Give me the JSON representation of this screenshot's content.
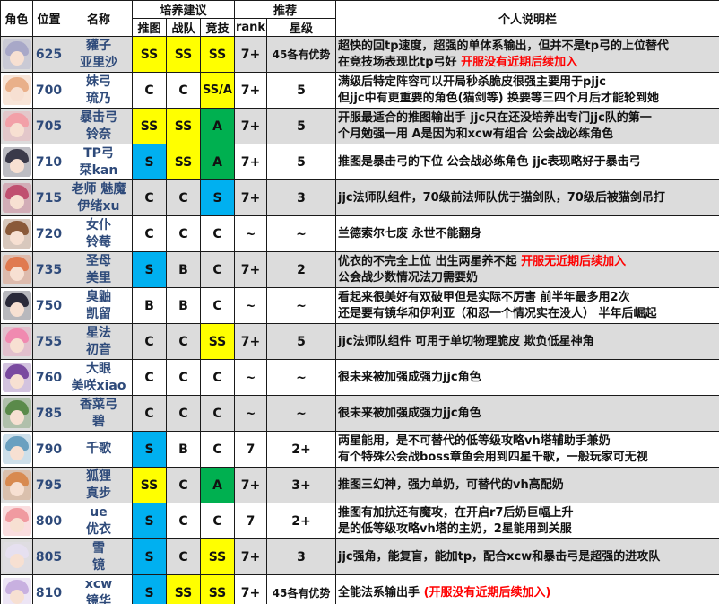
{
  "header": {
    "col_role": "角色",
    "col_pos": "位置",
    "col_name": "名称",
    "group_train": "培养建议",
    "col_push": "推图",
    "col_team": "战队",
    "col_arena": "竞技",
    "group_rec": "推荐",
    "col_rank": "rank",
    "col_star": "星级",
    "col_note": "个人说明栏"
  },
  "colors": {
    "SS": "#ffff00",
    "S": "#00b0f0",
    "A": "#00b050",
    "shade": "#dcdcdc",
    "name_text": "#2e4a7a",
    "highlight_text": "#ff0000"
  },
  "rows": [
    {
      "pos": "625",
      "name1": "䝔子",
      "name2": "亚里沙",
      "push": "SS",
      "team": "SS",
      "arena": "SS",
      "rank": "7+",
      "star": "45各有优势",
      "note1": "超快的回tp速度，超强的单体系输出，但并不是tp弓的上位替代",
      "note2": "在竞技场表现比tp弓好",
      "note2_red": "开服没有近期后续加入",
      "avatar_icon": "aris-avatar-icon",
      "hair": "#a8a8c8"
    },
    {
      "pos": "700",
      "name1": "妹弓",
      "name2": "琉乃",
      "push": "C",
      "team": "C",
      "arena": "SS/A",
      "rank": "7+",
      "star": "5",
      "note1": "满级后特定阵容可以开局秒杀脆皮很强主要用于pjjc",
      "note2": "但jjc中有更重要的角色(猫剑等)  换要等三四个月后才能轮到她",
      "note2_red": "",
      "avatar_icon": "rino-avatar-icon",
      "hair": "#e9b08a"
    },
    {
      "pos": "705",
      "name1": "暴击弓",
      "name2": "铃奈",
      "push": "SS",
      "team": "SS",
      "arena": "A",
      "rank": "7+",
      "star": "5",
      "note1": "开服最适合的推图输出手 jjc只在还没培养出专门jjc队的第一",
      "note2": "个月勉强一用  A是因为和xcw有组合      公会战必练角色",
      "note2_red": "",
      "avatar_icon": "suzuna-avatar-icon",
      "hair": "#f2a0a8"
    },
    {
      "pos": "710",
      "name1": "TP弓",
      "name2": "栞kan",
      "push": "S",
      "team": "SS",
      "arena": "A",
      "rank": "7+",
      "star": "5",
      "note1": "推图是暴击弓的下位  公会战必练角色  jjc表现略好于暴击弓",
      "note2": "",
      "note2_red": "",
      "avatar_icon": "shiori-avatar-icon",
      "hair": "#3a3a4a"
    },
    {
      "pos": "715",
      "name1": "老师 魅魔",
      "name2": "伊绪xu",
      "push": "C",
      "team": "C",
      "arena": "S",
      "rank": "7+",
      "star": "3",
      "note1": "jjc法师队组件，70级前法师队优于猫剑队，70级后被猫剑吊打",
      "note2": "",
      "note2_red": "",
      "avatar_icon": "io-avatar-icon",
      "hair": "#c05070"
    },
    {
      "pos": "720",
      "name1": "女仆",
      "name2": "铃莓",
      "push": "C",
      "team": "C",
      "arena": "C",
      "rank": "~",
      "star": "~",
      "note1": "兰德索尔七废 永世不能翻身",
      "note2": "",
      "note2_red": "",
      "avatar_icon": "suzume-avatar-icon",
      "hair": "#8a5a3a"
    },
    {
      "pos": "735",
      "name1": "圣母",
      "name2": "美里",
      "push": "S",
      "team": "B",
      "arena": "C",
      "rank": "7+",
      "star": "2",
      "note1": "优衣的不完全上位 出生两星养不起",
      "note1_red": "开服无近期后续加入",
      "note2": "公会战少数情况法刀需要奶",
      "note2_red": "",
      "avatar_icon": "misato-avatar-icon",
      "hair": "#e07a50"
    },
    {
      "pos": "750",
      "name1": "臭鼬",
      "name2": "凯留",
      "push": "B",
      "team": "B",
      "arena": "C",
      "rank": "~",
      "star": "~",
      "note1": "看起来很美好有双破甲但是实际不厉害      前半年最多用2次",
      "note2": "还是要有镜华和伊利亚（和忍一个情况实在没人）  半年后崛起",
      "note2_red": "",
      "avatar_icon": "kyaru-avatar-icon",
      "hair": "#2a2a3a"
    },
    {
      "pos": "755",
      "name1": "星法",
      "name2": "初音",
      "push": "C",
      "team": "C",
      "arena": "SS",
      "rank": "7+",
      "star": "5",
      "note1": "jjc法师队组件   可用于单切物理脆皮 欺负低星神角",
      "note2": "",
      "note2_red": "",
      "avatar_icon": "hatsune-avatar-icon",
      "hair": "#f08ab0"
    },
    {
      "pos": "760",
      "name1": "大眼",
      "name2": "美咲xiao",
      "push": "C",
      "team": "C",
      "arena": "C",
      "rank": "~",
      "star": "~",
      "note1": "很未来被加强成强力jjc角色",
      "note2": "",
      "note2_red": "",
      "avatar_icon": "misaki-avatar-icon",
      "hair": "#7a4aa0"
    },
    {
      "pos": "785",
      "name1": "香菜弓",
      "name2": "碧",
      "push": "C",
      "team": "C",
      "arena": "C",
      "rank": "~",
      "star": "~",
      "note1": "很未来被加强成强力jjc角色",
      "note2": "",
      "note2_red": "",
      "avatar_icon": "aoi-avatar-icon",
      "hair": "#5a8a4a"
    },
    {
      "pos": "790",
      "name1": "千歌",
      "name2": "",
      "push": "S",
      "team": "B",
      "arena": "C",
      "rank": "7",
      "star": "2+",
      "note1": "两星能用，是不可替代的低等级攻略vh塔辅助手兼奶",
      "note2": "有个特殊公会战boss章鱼会用到四星千歌，一般玩家可无视",
      "note2_red": "",
      "avatar_icon": "chika-avatar-icon",
      "hair": "#6aa0c0"
    },
    {
      "pos": "795",
      "name1": "狐狸",
      "name2": "真步",
      "push": "SS",
      "team": "C",
      "arena": "A",
      "rank": "7+",
      "star": "3+",
      "note1": "推图三幻神，强力单奶，可替代的vh高配奶",
      "note2": "",
      "note2_red": "",
      "avatar_icon": "maho-avatar-icon",
      "hair": "#d88a50"
    },
    {
      "pos": "800",
      "name1": "ue",
      "name2": "优衣",
      "push": "S",
      "team": "C",
      "arena": "C",
      "rank": "7",
      "star": "2+",
      "note1": "推图有加抗还有魔攻，在开启r7后奶巨幅上升",
      "note2": "是的低等级攻略vh塔的主奶，2星能用到关服",
      "note2_red": "",
      "avatar_icon": "yui-avatar-icon",
      "hair": "#f09aa0"
    },
    {
      "pos": "805",
      "name1": "雪",
      "name2": "镜",
      "push": "S",
      "team": "C",
      "arena": "SS",
      "rank": "7+",
      "star": "3",
      "note1": "jjc强角，能复盲，能加tp，配合xcw和暴击弓是超强的进攻队",
      "note2": "",
      "note2_red": "",
      "avatar_icon": "yuki-avatar-icon",
      "hair": "#e6e0f0"
    },
    {
      "pos": "810",
      "name1": "xcw",
      "name2": "镜华",
      "push": "S",
      "team": "SS",
      "arena": "SS",
      "rank": "7+",
      "star": "45各有优势",
      "note1": "全能法系输出手",
      "note1_red": "(开服没有近期后续加入)",
      "note2": "",
      "note2_red": "",
      "avatar_icon": "kyouka-avatar-icon",
      "hair": "#c8b0e0"
    }
  ]
}
